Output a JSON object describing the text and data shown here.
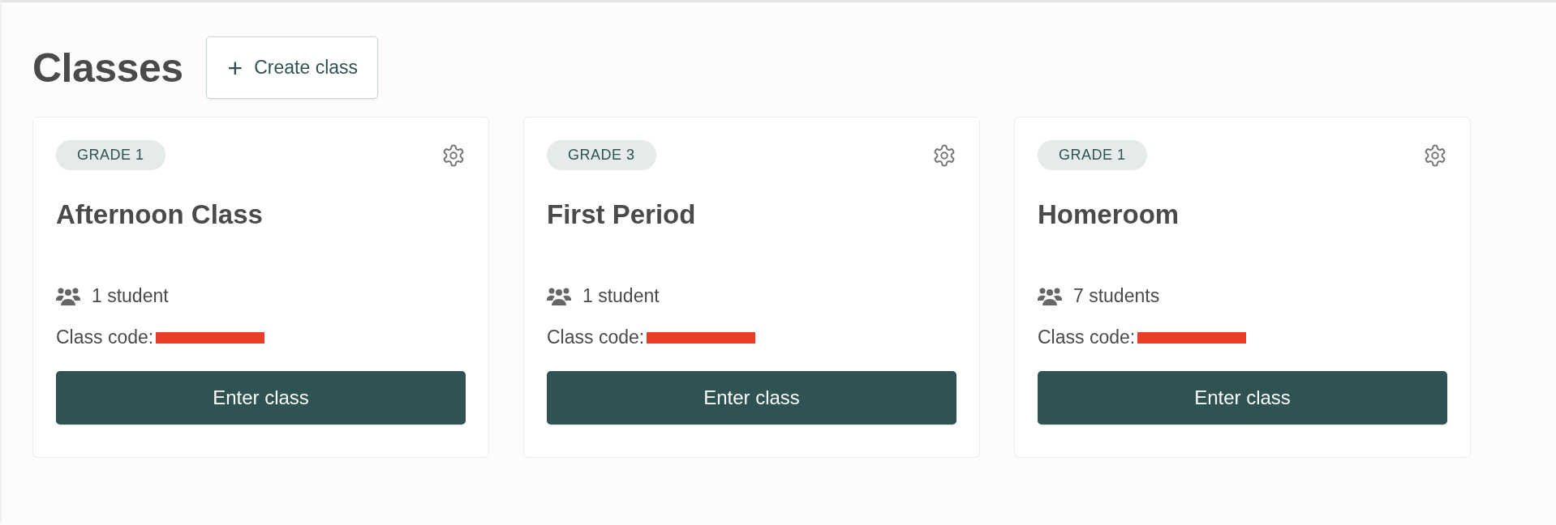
{
  "title": "Classes",
  "create_button": {
    "icon": "+",
    "label": "Create class"
  },
  "classes": [
    {
      "grade": "GRADE 1",
      "name": "Afternoon Class",
      "students": "1 student",
      "code_label": "Class code:",
      "code_redacted": true,
      "button": "Enter class"
    },
    {
      "grade": "GRADE 3",
      "name": "First Period",
      "students": "1 student",
      "code_label": "Class code:",
      "code_redacted": true,
      "button": "Enter class"
    },
    {
      "grade": "GRADE 1",
      "name": "Homeroom",
      "students": "7 students",
      "code_label": "Class code:",
      "code_redacted": true,
      "button": "Enter class"
    }
  ]
}
